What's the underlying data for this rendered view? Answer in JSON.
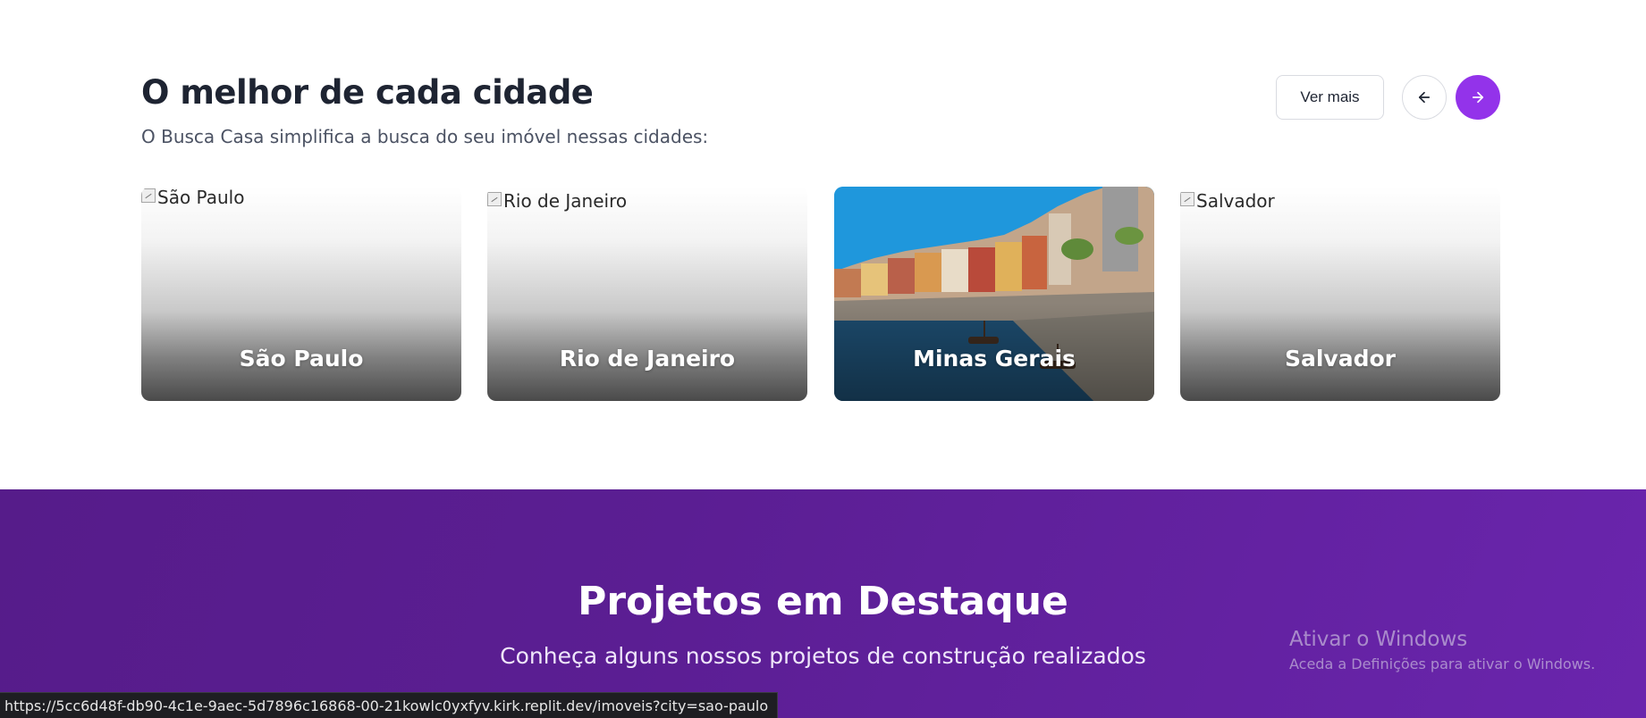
{
  "cities_section": {
    "title": "O melhor de cada cidade",
    "subtitle": "O Busca Casa simplifica a busca do seu imóvel nessas cidades:",
    "ver_mais_label": "Ver mais",
    "prev_icon": "arrow-left-icon",
    "next_icon": "arrow-right-icon",
    "accent_color": "#9333ea",
    "cards": [
      {
        "alt": "São Paulo",
        "name": "São Paulo",
        "image_loaded": false
      },
      {
        "alt": "Rio de Janeiro",
        "name": "Rio de Janeiro",
        "image_loaded": false
      },
      {
        "alt": "Minas Gerais",
        "name": "Minas Gerais",
        "image_loaded": true
      },
      {
        "alt": "Salvador",
        "name": "Salvador",
        "image_loaded": false
      }
    ]
  },
  "projects_section": {
    "title": "Projetos em Destaque",
    "subtitle": "Conheça alguns nossos projetos de construção realizados"
  },
  "windows_watermark": {
    "title": "Ativar o Windows",
    "subtitle": "Aceda a Definições para ativar o Windows."
  },
  "status_bar": {
    "url": "https://5cc6d48f-db90-4c1e-9aec-5d7896c16868-00-21kowlc0yxfyv.kirk.replit.dev/imoveis?city=sao-paulo"
  }
}
